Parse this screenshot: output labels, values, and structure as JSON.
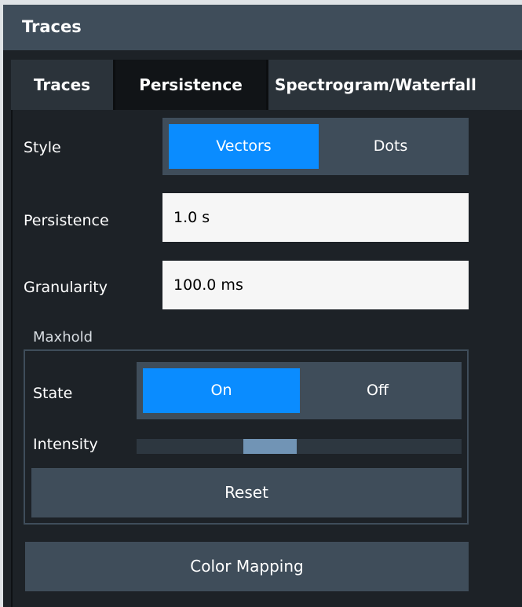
{
  "window": {
    "title": "Traces"
  },
  "tabs": [
    {
      "label": "Traces",
      "active": false
    },
    {
      "label": "Persistence",
      "active": true
    },
    {
      "label": "Spectrogram/Waterfall",
      "active": false
    }
  ],
  "style": {
    "label": "Style",
    "options": [
      "Vectors",
      "Dots"
    ],
    "selected": "Vectors"
  },
  "persistence": {
    "label": "Persistence",
    "value": "1.0 s"
  },
  "granularity": {
    "label": "Granularity",
    "value": "100.0 ms"
  },
  "maxhold": {
    "title": "Maxhold",
    "state": {
      "label": "State",
      "options": [
        "On",
        "Off"
      ],
      "selected": "On"
    },
    "intensity": {
      "label": "Intensity",
      "level": 0.33
    },
    "reset_label": "Reset"
  },
  "color_mapping_label": "Color Mapping",
  "colors": {
    "accent": "#0a8cff",
    "panel": "#3f4d5a",
    "background": "#1d2227"
  }
}
